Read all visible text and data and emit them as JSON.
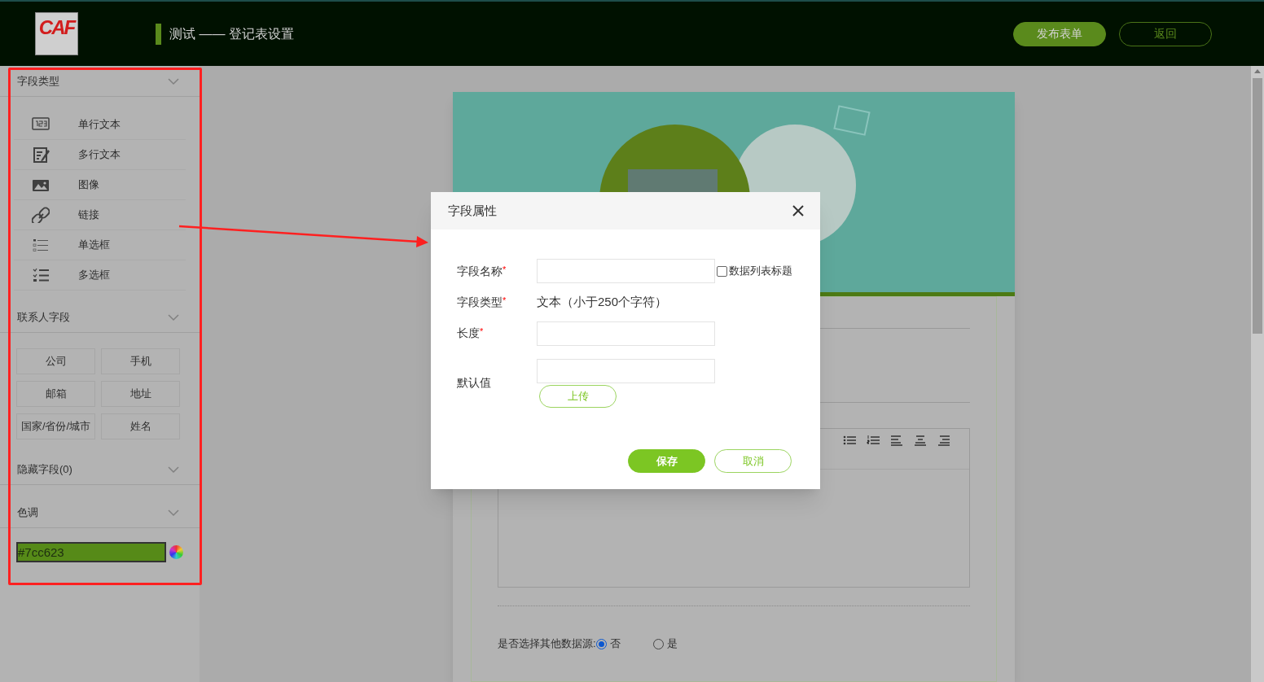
{
  "header": {
    "logo_text": "CAF",
    "title": "测试 —— 登记表设置",
    "buttons": [
      {
        "label": "发布表单",
        "kind": "primary"
      },
      {
        "label": "返回",
        "kind": "outline"
      }
    ]
  },
  "sidebar": {
    "field_types": {
      "title": "字段类型",
      "items": [
        {
          "label": "单行文本",
          "kind": "number"
        },
        {
          "label": "多行文本",
          "kind": "edit"
        },
        {
          "label": "图像",
          "kind": "image"
        },
        {
          "label": "链接",
          "kind": "link"
        },
        {
          "label": "单选框",
          "kind": "radio"
        },
        {
          "label": "多选框",
          "kind": "checklist"
        }
      ]
    },
    "contact_fields": {
      "title": "联系人字段",
      "buttons": [
        "公司",
        "手机",
        "邮箱",
        "地址",
        "国家/省份/城市",
        "姓名"
      ]
    },
    "hidden_fields": {
      "title": "隐藏字段(0)"
    },
    "tone": {
      "title": "色调",
      "value": "#7cc623"
    }
  },
  "form": {
    "radio_group": {
      "label": "是否选择其他数据源:",
      "options": [
        {
          "label": "否",
          "selected": true
        },
        {
          "label": "是",
          "selected": false
        }
      ]
    }
  },
  "dialog": {
    "title": "字段属性",
    "fields": [
      {
        "label": "字段名称",
        "mark": "*",
        "kind": "input",
        "checkbox": {
          "label": "数据列表标题",
          "checked": false
        }
      },
      {
        "label": "字段类型",
        "mark": "*",
        "kind": "text",
        "value": "文本（小于250个字符）"
      },
      {
        "label": "长度",
        "mark": "*",
        "kind": "input"
      },
      {
        "label": "默认值",
        "kind": "upload",
        "button": "上传"
      }
    ],
    "buttons": [
      {
        "label": "保存",
        "kind": "primary"
      },
      {
        "label": "取消",
        "kind": "outline"
      }
    ]
  }
}
